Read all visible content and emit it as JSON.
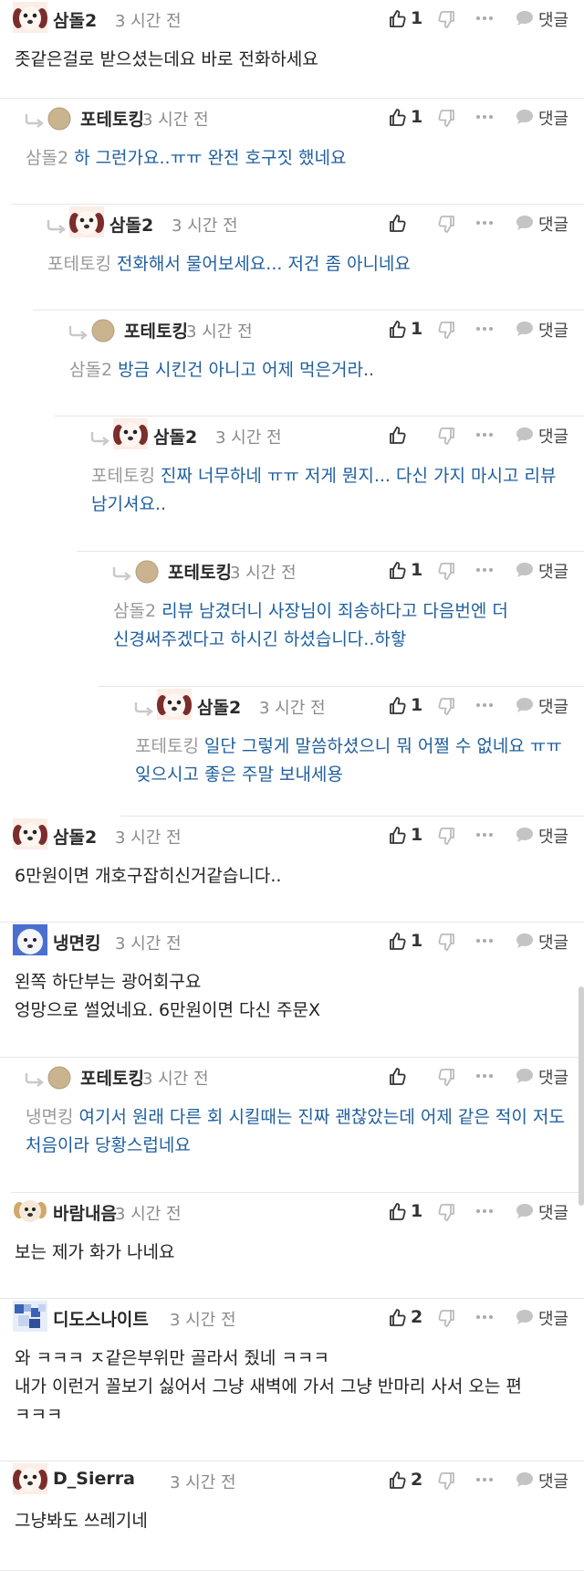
{
  "ui": {
    "like_icon": "thumbs-up-icon",
    "dislike_icon": "thumbs-down-icon",
    "more_icon": "more-icon",
    "reply_icon": "speech-bubble-icon",
    "reply_label": "댓글",
    "accent_reply_color": "#1f5f9f"
  },
  "comments": [
    {
      "author": "삼돌2",
      "time": "3 시간 전",
      "likes": "1",
      "avatar": "dog-avatar",
      "text": "좃같은걸로 받으셨는데요 바로 전화하세요",
      "mention": "",
      "is_reply": false
    },
    {
      "author": "포테토킹",
      "time": "3 시간 전",
      "likes": "1",
      "avatar": "dot-avatar",
      "text": "하 그런가요..ㅠㅠ 완전 호구짓 했네요",
      "mention": "삼돌2",
      "is_reply": true
    },
    {
      "author": "삼돌2",
      "time": "3 시간 전",
      "likes": "",
      "avatar": "dog-avatar",
      "text": "전화해서 물어보세요... 저건 좀 아니네요",
      "mention": "포테토킹",
      "is_reply": true
    },
    {
      "author": "포테토킹",
      "time": "3 시간 전",
      "likes": "1",
      "avatar": "dot-avatar",
      "text": "방금 시킨건 아니고 어제 먹은거라..",
      "mention": "삼돌2",
      "is_reply": true
    },
    {
      "author": "삼돌2",
      "time": "3 시간 전",
      "likes": "",
      "avatar": "dog-avatar",
      "text": "진짜 너무하네 ㅠㅠ 저게 뭔지... 다신 가지 마시고 리뷰 남기셔요..",
      "mention": "포테토킹",
      "is_reply": true
    },
    {
      "author": "포테토킹",
      "time": "3 시간 전",
      "likes": "1",
      "avatar": "dot-avatar",
      "text": "리뷰 남겼더니 사장님이 죄송하다고 다음번엔 더 신경써주겠다고 하시긴 하셨습니다..하핳",
      "mention": "삼돌2",
      "is_reply": true
    },
    {
      "author": "삼돌2",
      "time": "3 시간 전",
      "likes": "1",
      "avatar": "dog-avatar",
      "text": "일단 그렇게 말씀하셨으니 뭐 어쩔 수 없네요 ㅠㅠ 잊으시고 좋은 주말 보내세용",
      "mention": "포테토킹",
      "is_reply": true
    },
    {
      "author": "삼돌2",
      "time": "3 시간 전",
      "likes": "1",
      "avatar": "dog-avatar",
      "text": "6만원이면 개호구잡히신거같습니다..",
      "mention": "",
      "is_reply": false
    },
    {
      "author": "냉면킹",
      "time": "3 시간 전",
      "likes": "1",
      "avatar": "white-dog-avatar",
      "text": "왼쪽 하단부는 광어회구요\n엉망으로 썰었네요. 6만원이면 다신 주문X",
      "mention": "",
      "is_reply": false
    },
    {
      "author": "포테토킹",
      "time": "3 시간 전",
      "likes": "",
      "avatar": "dot-avatar",
      "text": "여기서 원래 다른 회 시킬때는 진짜 괜찮았는데 어제 같은 적이 저도 처음이라 당황스럽네요",
      "mention": "냉면킹",
      "is_reply": true
    },
    {
      "author": "바람내음",
      "time": "3 시간 전",
      "likes": "1",
      "avatar": "puppy-avatar",
      "text": "보는 제가 화가 나네요",
      "mention": "",
      "is_reply": false
    },
    {
      "author": "디도스나이트",
      "time": "3 시간 전",
      "likes": "2",
      "avatar": "pixel-avatar",
      "text": "와 ㅋㅋㅋ ㅈ같은부위만 골라서 줬네 ㅋㅋㅋ\n내가 이런거 꼴보기 싫어서 그냥 새벽에 가서 그냥 반마리 사서 오는 편 ㅋㅋㅋ",
      "mention": "",
      "is_reply": false
    },
    {
      "author": "D_Sierra",
      "time": "3 시간 전",
      "likes": "2",
      "avatar": "dog-avatar",
      "text": "그냥봐도 쓰레기네",
      "mention": "",
      "is_reply": false
    }
  ]
}
